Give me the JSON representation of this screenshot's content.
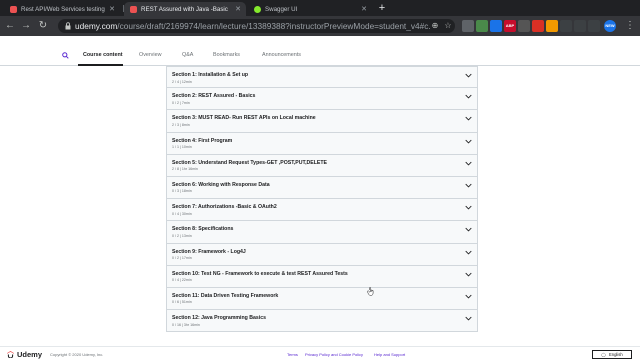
{
  "browser": {
    "tabs": [
      {
        "title": "Rest API/Web Services testing",
        "favicon_color": "#ec5252"
      },
      {
        "title": "REST Assured with Java -Basic",
        "favicon_color": "#ec5252"
      },
      {
        "title": "Swagger UI",
        "favicon_color": "#85ea2d"
      }
    ],
    "url_host": "udemy.com",
    "url_path": "/course/draft/2169974/learn/lecture/13389388?instructorPreviewMode=student_v4#c...",
    "extensions": [
      {
        "label": "",
        "color": "#5f6368"
      },
      {
        "label": "",
        "color": "#4a8a4a"
      },
      {
        "label": "",
        "color": "#1a73e8"
      },
      {
        "label": "ABP",
        "color": "#c70d2c"
      },
      {
        "label": "",
        "color": "#555"
      },
      {
        "label": "",
        "color": "#d93025"
      },
      {
        "label": "",
        "color": "#f29900"
      },
      {
        "label": "NEW",
        "color": "#1a73e8"
      }
    ]
  },
  "content_tabs": {
    "items": [
      "Course content",
      "Overview",
      "Q&A",
      "Bookmarks",
      "Announcements"
    ]
  },
  "sections": [
    {
      "title": "Section 1: Installation & Set up",
      "meta": "2 / 4 | 12min"
    },
    {
      "title": "Section 2: REST Assured - Basics",
      "meta": "0 / 2 | 7min"
    },
    {
      "title": "Section 3: MUST READ- Run REST APIs on Local machine",
      "meta": "2 / 3 | 8min"
    },
    {
      "title": "Section 4: First Program",
      "meta": "1 / 1 | 10min"
    },
    {
      "title": "Section 5: Understand Request Types-GET ,POST,PUT,DELETE",
      "meta": "2 / 8 | 1hr 16min"
    },
    {
      "title": "Section 6: Working with Response Data",
      "meta": "0 / 3 | 18min"
    },
    {
      "title": "Section 7: Authorizations -Basic & OAuth2",
      "meta": "0 / 4 | 30min"
    },
    {
      "title": "Section 8: Specifications",
      "meta": "0 / 2 | 13min"
    },
    {
      "title": "Section 9: Framework - Log4J",
      "meta": "0 / 2 | 17min"
    },
    {
      "title": "Section 10: Test NG - Framework to execute & test REST Assured Tests",
      "meta": "0 / 4 | 22min"
    },
    {
      "title": "Section 11: Data Driven Testing Framework",
      "meta": "0 / 6 | 51min"
    },
    {
      "title": "Section 12: Java Programming Basics",
      "meta": "0 / 16 | 3hr 16min"
    }
  ],
  "footer": {
    "logo_text": "Udemy",
    "copyright": "Copyright © 2020 Udemy, Inc.",
    "links": [
      "Terms",
      "Privacy Policy and Cookie Policy",
      "Help and Support"
    ],
    "language": "English"
  },
  "colors": {
    "chrome_dark": "#202124",
    "chrome_toolbar": "#35363a",
    "udemy_brand": "#ec5252",
    "link": "#5624d0",
    "section_bg": "#f7f9fa"
  }
}
